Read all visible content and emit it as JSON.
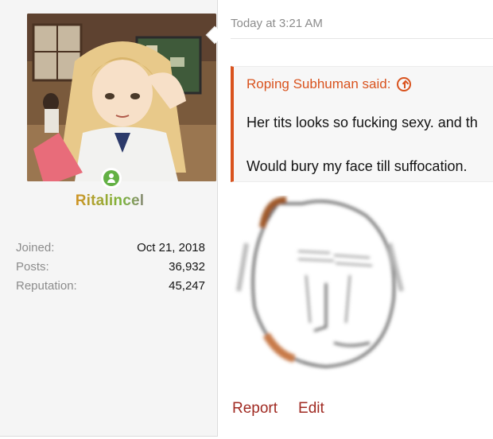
{
  "user": {
    "name": "Ritalincel",
    "avatar_icon": "anime-avatar-image",
    "online_icon": "online-user-icon",
    "stats": [
      {
        "label": "Joined:",
        "value": "Oct 21, 2018"
      },
      {
        "label": "Posts:",
        "value": "36,932"
      },
      {
        "label": "Reputation:",
        "value": "45,247"
      }
    ]
  },
  "post": {
    "date": "Today at 3:21 AM",
    "quote": {
      "author_line": "Roping Subhuman said:",
      "jump_icon": "arrow-up-circle-icon",
      "lines": [
        "Her tits looks so fucking sexy. and th",
        "Would bury my face till suffocation."
      ]
    },
    "image_icon": "wojak-meme-image"
  },
  "actions": {
    "report": "Report",
    "edit": "Edit"
  },
  "colors": {
    "quote_accent": "#d9531e",
    "action_link": "#a02a22",
    "online": "#63b144",
    "panel_bg": "#f5f5f5"
  }
}
